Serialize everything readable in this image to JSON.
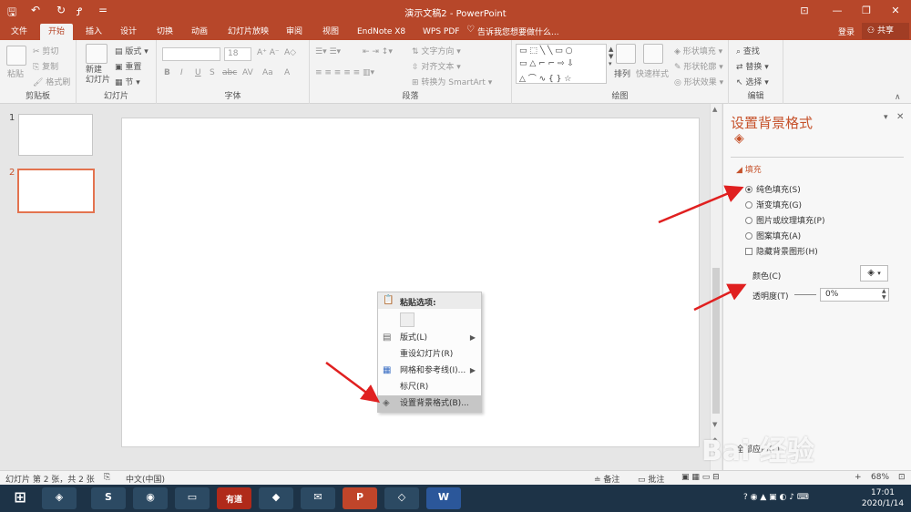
{
  "window": {
    "title": "演示文稿2 - PowerPoint",
    "controls": [
      "⊡",
      "—",
      "❐",
      "✕"
    ]
  },
  "quick_access": [
    "🖫",
    "↶",
    "↻",
    "Ꝭ",
    "="
  ],
  "tabs": [
    {
      "label": "文件"
    },
    {
      "label": "开始"
    },
    {
      "label": "插入"
    },
    {
      "label": "设计"
    },
    {
      "label": "切换"
    },
    {
      "label": "动画"
    },
    {
      "label": "幻灯片放映"
    },
    {
      "label": "审阅"
    },
    {
      "label": "视图"
    },
    {
      "label": "EndNote X8"
    },
    {
      "label": "WPS PDF"
    }
  ],
  "tell_me": "告诉我您想要做什么...",
  "account": {
    "login": "登录",
    "share": "共享"
  },
  "ribbon": {
    "clipboard": {
      "label": "剪贴板",
      "paste": "粘贴",
      "cut": "剪切",
      "copy": "复制",
      "format_painter": "格式刷"
    },
    "slides": {
      "label": "幻灯片",
      "new_slide": "新建\n幻灯片",
      "layout": "版式",
      "reset": "重置",
      "section": "节"
    },
    "font": {
      "label": "字体",
      "size": "18",
      "buttons": [
        "B",
        "I",
        "U",
        "S",
        "abc",
        "AV",
        "Aa",
        "A"
      ]
    },
    "paragraph": {
      "label": "段落",
      "text_direction": "文字方向",
      "align_text": "对齐文本",
      "smartart": "转换为 SmartArt"
    },
    "drawing": {
      "label": "绘图",
      "arrange": "排列",
      "quick_styles": "快速样式",
      "shape_fill": "形状填充",
      "shape_outline": "形状轮廓",
      "shape_effects": "形状效果"
    },
    "editing": {
      "label": "编辑",
      "find": "查找",
      "replace": "替换",
      "select": "选择"
    }
  },
  "slides": [
    {
      "number": "1"
    },
    {
      "number": "2"
    }
  ],
  "context_menu": {
    "paste_options": "粘贴选项:",
    "items": [
      {
        "label": "版式(L)",
        "submenu": true
      },
      {
        "label": "重设幻灯片(R)",
        "submenu": false
      },
      {
        "label": "网格和参考线(I)...",
        "submenu": true
      },
      {
        "label": "标尺(R)",
        "submenu": false
      },
      {
        "label": "设置背景格式(B)...",
        "submenu": false
      }
    ]
  },
  "format_pane": {
    "title": "设置背景格式",
    "section": "填充",
    "options": [
      {
        "label": "纯色填充(S)",
        "selected": true
      },
      {
        "label": "渐变填充(G)",
        "selected": false
      },
      {
        "label": "图片或纹理填充(P)",
        "selected": false
      },
      {
        "label": "图案填充(A)",
        "selected": false
      }
    ],
    "hide_graphics": "隐藏背景图形(H)",
    "color_label": "颜色(C)",
    "transparency_label": "透明度(T)",
    "transparency_value": "0%",
    "apply_all": "全部应用(L)"
  },
  "status": {
    "slide_info": "幻灯片 第 2 张，共 2 张",
    "language": "中文(中国)",
    "notes": "备注",
    "comments": "批注",
    "zoom": "68%"
  },
  "taskbar": {
    "apps": [
      "⊞",
      "◈",
      "S",
      "◉",
      "▭",
      "有道",
      "◆",
      "✉",
      "P",
      "◇",
      "W"
    ],
    "time": "17:01",
    "date": "2020/1/14"
  },
  "watermark": "Bai 经验",
  "colors": {
    "accent": "#b7472a",
    "pane_title": "#c6522b",
    "arrow": "#e02020"
  }
}
